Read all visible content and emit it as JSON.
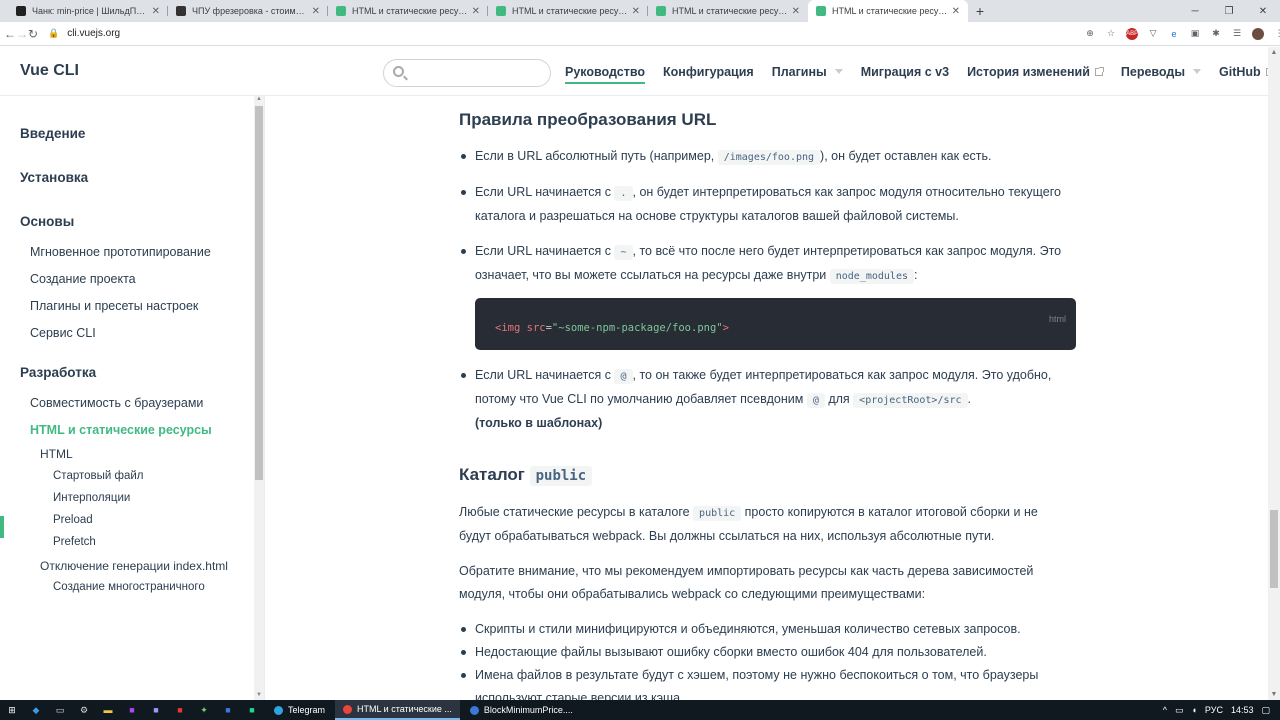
{
  "browser": {
    "tabs": [
      {
        "title": "Чанк: min-price | ШильдПанель",
        "fav": "#222222",
        "active": false
      },
      {
        "title": "ЧПУ фрезеровка - стоимость ф",
        "fav": "#333333",
        "active": false
      },
      {
        "title": "HTML и статические ресурсы |",
        "fav": "#42b983",
        "active": false
      },
      {
        "title": "HTML и статические ресурсы |",
        "fav": "#42b983",
        "active": false
      },
      {
        "title": "HTML и статические ресурсы |",
        "fav": "#42b983",
        "active": false
      },
      {
        "title": "HTML и статические ресурсы |",
        "fav": "#42b983",
        "active": true
      }
    ],
    "tab_close": "✕",
    "new_tab": "+",
    "url": "cli.vuejs.org"
  },
  "site": {
    "logo": "Vue CLI",
    "search_placeholder": "",
    "nav": [
      {
        "label": "Руководство",
        "active": true,
        "dropdown": false,
        "external": false
      },
      {
        "label": "Конфигурация",
        "active": false,
        "dropdown": false,
        "external": false
      },
      {
        "label": "Плагины",
        "active": false,
        "dropdown": true,
        "external": false
      },
      {
        "label": "Миграция с v3",
        "active": false,
        "dropdown": false,
        "external": false
      },
      {
        "label": "История изменений",
        "active": false,
        "dropdown": false,
        "external": true
      },
      {
        "label": "Переводы",
        "active": false,
        "dropdown": true,
        "external": false
      },
      {
        "label": "GitHub",
        "active": false,
        "dropdown": false,
        "external": true
      }
    ]
  },
  "sidebar": {
    "items": [
      {
        "label": "Введение",
        "level": "group"
      },
      {
        "label": "Установка",
        "level": "group"
      },
      {
        "label": "Основы",
        "level": "group"
      },
      {
        "label": "Мгновенное прототипирование",
        "level": "link"
      },
      {
        "label": "Создание проекта",
        "level": "link"
      },
      {
        "label": "Плагины и пресеты настроек",
        "level": "link"
      },
      {
        "label": "Сервис CLI",
        "level": "link"
      },
      {
        "label": "Разработка",
        "level": "group"
      },
      {
        "label": "Совместимость с браузерами",
        "level": "link"
      },
      {
        "label": "HTML и статические ресурсы",
        "level": "link",
        "active": true
      },
      {
        "label": "HTML",
        "level": "sub"
      },
      {
        "label": "Стартовый файл",
        "level": "subsub"
      },
      {
        "label": "Интерполяции",
        "level": "subsub"
      },
      {
        "label": "Preload",
        "level": "subsub"
      },
      {
        "label": "Prefetch",
        "level": "subsub"
      },
      {
        "label": "Отключение генерации index.html",
        "level": "sub"
      },
      {
        "label": "Создание многостраничного",
        "level": "subsub"
      }
    ]
  },
  "content": {
    "h_url_rules": "Правила преобразования URL",
    "b1": {
      "pre": "Если в URL абсолютный путь (например, ",
      "code": "/images/foo.png",
      "post": "), он будет оставлен как есть."
    },
    "b2": {
      "pre": "Если URL начинается с ",
      "code": ".",
      "post": ", он будет интерпретироваться как запрос модуля относительно текущего каталога и разрешаться на основе структуры каталогов вашей файловой системы."
    },
    "b3": {
      "pre": "Если URL начинается с ",
      "code": "~",
      "mid": ", то всё что после него будет интерпретироваться как запрос модуля. Это означает, что вы можете ссылаться на ресурсы даже внутри ",
      "code2": "node_modules",
      "post": ":"
    },
    "codeblock": {
      "lang": "html",
      "tag_open": "<img",
      "attr": "src",
      "eq": "=",
      "value": "\"~some-npm-package/foo.png\"",
      "tag_close": ">"
    },
    "b4": {
      "pre": "Если URL начинается с ",
      "code": "@",
      "mid": ", то он также будет интерпретироваться как запрос модуля. Это удобно, потому что Vue CLI по умолчанию добавляет псевдоним ",
      "code2": "@",
      "mid2": " для ",
      "code3": "<projectRoot>/src",
      "post": ".",
      "bold": "(только в шаблонах)"
    },
    "h_public": "Каталог",
    "h_public_code": "public",
    "p1": {
      "pre": "Любые статические ресурсы в каталоге ",
      "code": "public",
      "post": " просто копируются в каталог итоговой сборки и не будут обрабатываться webpack. Вы должны ссылаться на них, используя абсолютные пути."
    },
    "p2": "Обратите внимание, что мы рекомендуем импортировать ресурсы как часть дерева зависимостей модуля, чтобы они обрабатывались webpack со следующими преимуществами:",
    "list": [
      "Скрипты и стили минифицируются и объединяются, уменьшая количество сетевых запросов.",
      "Недостающие файлы вызывают ошибку сборки вместо ошибок 404 для пользователей.",
      "Имена файлов в результате будут с хэшем, поэтому не нужно беспокоиться о том, что браузеры используют старые версии из кэша."
    ]
  },
  "taskbar": {
    "apps": [
      {
        "label": "Telegram",
        "color": "#2ca5e0",
        "active": false
      },
      {
        "label": "HTML и статические ...",
        "color": "#e8453c",
        "active": true
      },
      {
        "label": "BlockMinimumPrice....",
        "color": "#3c78d8",
        "active": false
      }
    ],
    "lang": "РУС",
    "time": "14:53"
  },
  "colors": {
    "accent": "#42b983",
    "text": "#2c3e50"
  }
}
